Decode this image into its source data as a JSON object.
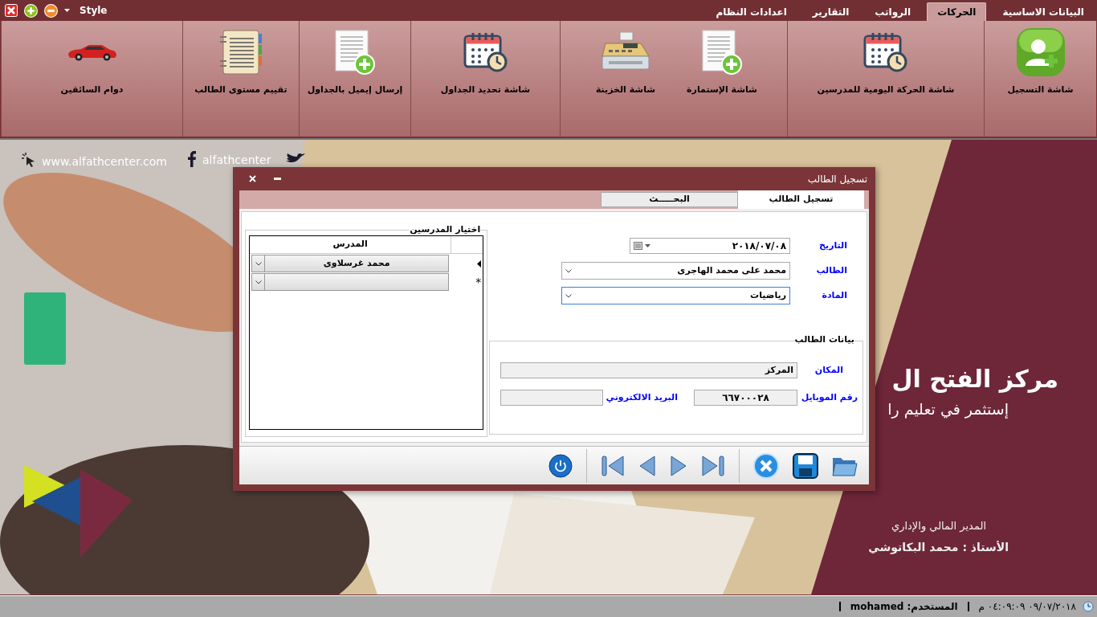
{
  "quick_access": {
    "label": "Style"
  },
  "menu_tabs": [
    {
      "label": "البيانات الاساسية",
      "selected": false
    },
    {
      "label": "الحركات",
      "selected": true
    },
    {
      "label": "الرواتب",
      "selected": false
    },
    {
      "label": "التقارير",
      "selected": false
    },
    {
      "label": "اعدادات النظام",
      "selected": false
    }
  ],
  "ribbon": {
    "groups": [
      {
        "buttons": [
          {
            "label": "شاشة التسجيل"
          }
        ]
      },
      {
        "buttons": [
          {
            "label": "شاشة الحركة اليومية للمدرسين"
          }
        ]
      },
      {
        "buttons": [
          {
            "label": "شاشة الإستمارة"
          },
          {
            "label": "شاشة الخزينة"
          }
        ]
      },
      {
        "buttons": [
          {
            "label": "شاشة تحديد الجداول"
          }
        ]
      },
      {
        "buttons": [
          {
            "label": "إرسال إيميل بالجداول"
          }
        ]
      },
      {
        "buttons": [
          {
            "label": "تقييم مستوى الطالب"
          }
        ]
      },
      {
        "buttons": [
          {
            "label": "دوام السائقين"
          }
        ]
      }
    ]
  },
  "banner": {
    "website": "www.alfathcenter.com",
    "social": "alfathcenter",
    "headline": "مركز الفتح ال",
    "slogan": "إستثمر في تعليم را",
    "role": "المدير المالي والإداري",
    "name": "الأستاذ : محمد البكاتوشي"
  },
  "dialog": {
    "title": "تسجيل الطالب",
    "tabs": [
      {
        "label": "تسجيل الطالب",
        "selected": true
      },
      {
        "label": "البحـــــث",
        "selected": false
      }
    ],
    "fields": [
      {
        "kind": "date",
        "label": "التاريخ",
        "value": "٢٠١٨/٠٧/٠٨",
        "focused": false
      },
      {
        "kind": "combo",
        "label": "الطالب",
        "value": "محمد على محمد الهاجرى",
        "focused": false
      },
      {
        "kind": "combo",
        "label": "المادة",
        "value": "رياضيات",
        "focused": true
      }
    ],
    "student_info": {
      "legend": "بيانات الطالب",
      "place": {
        "label": "المكان",
        "value": "المركز"
      },
      "mobile": {
        "label": "رقم الموبايل",
        "value": "٦٦٧٠٠٠٢٨"
      },
      "email": {
        "label": "البريد الالكتروني"
      }
    },
    "teachers": {
      "legend": "اختيار المدرسين",
      "column": "المدرس",
      "rows": [
        {
          "value": "محمد غرسلاوى",
          "selected": true
        },
        {
          "marker": "*",
          "selected": false
        }
      ]
    }
  },
  "status_bar": {
    "time": "٠٩/٠٧/٢٠١٨ ٠٤:٠٩:٠٩ م",
    "user": "المستخدم: mohamed"
  }
}
